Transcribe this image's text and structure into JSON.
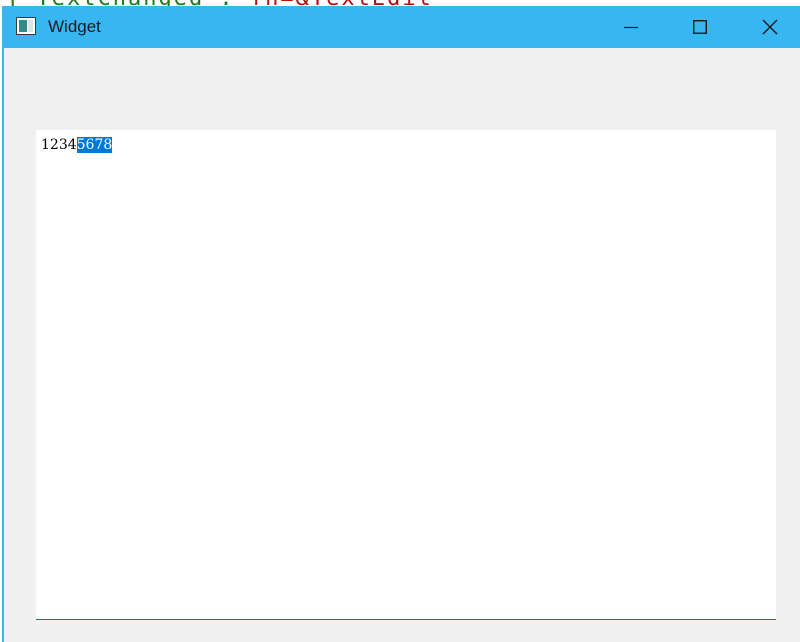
{
  "background_text": {
    "green": "{\"TextChanged\": ",
    "red": "fn=&TextEdit"
  },
  "window": {
    "title": "Widget",
    "title_bar_color": "#38b6f2"
  },
  "title_controls": {
    "minimize_icon": "minimize-icon",
    "maximize_icon": "maximize-icon",
    "close_icon": "close-icon"
  },
  "editor": {
    "text_unselected": "1234",
    "text_selected": "5678",
    "selection_color": "#0078d7"
  }
}
